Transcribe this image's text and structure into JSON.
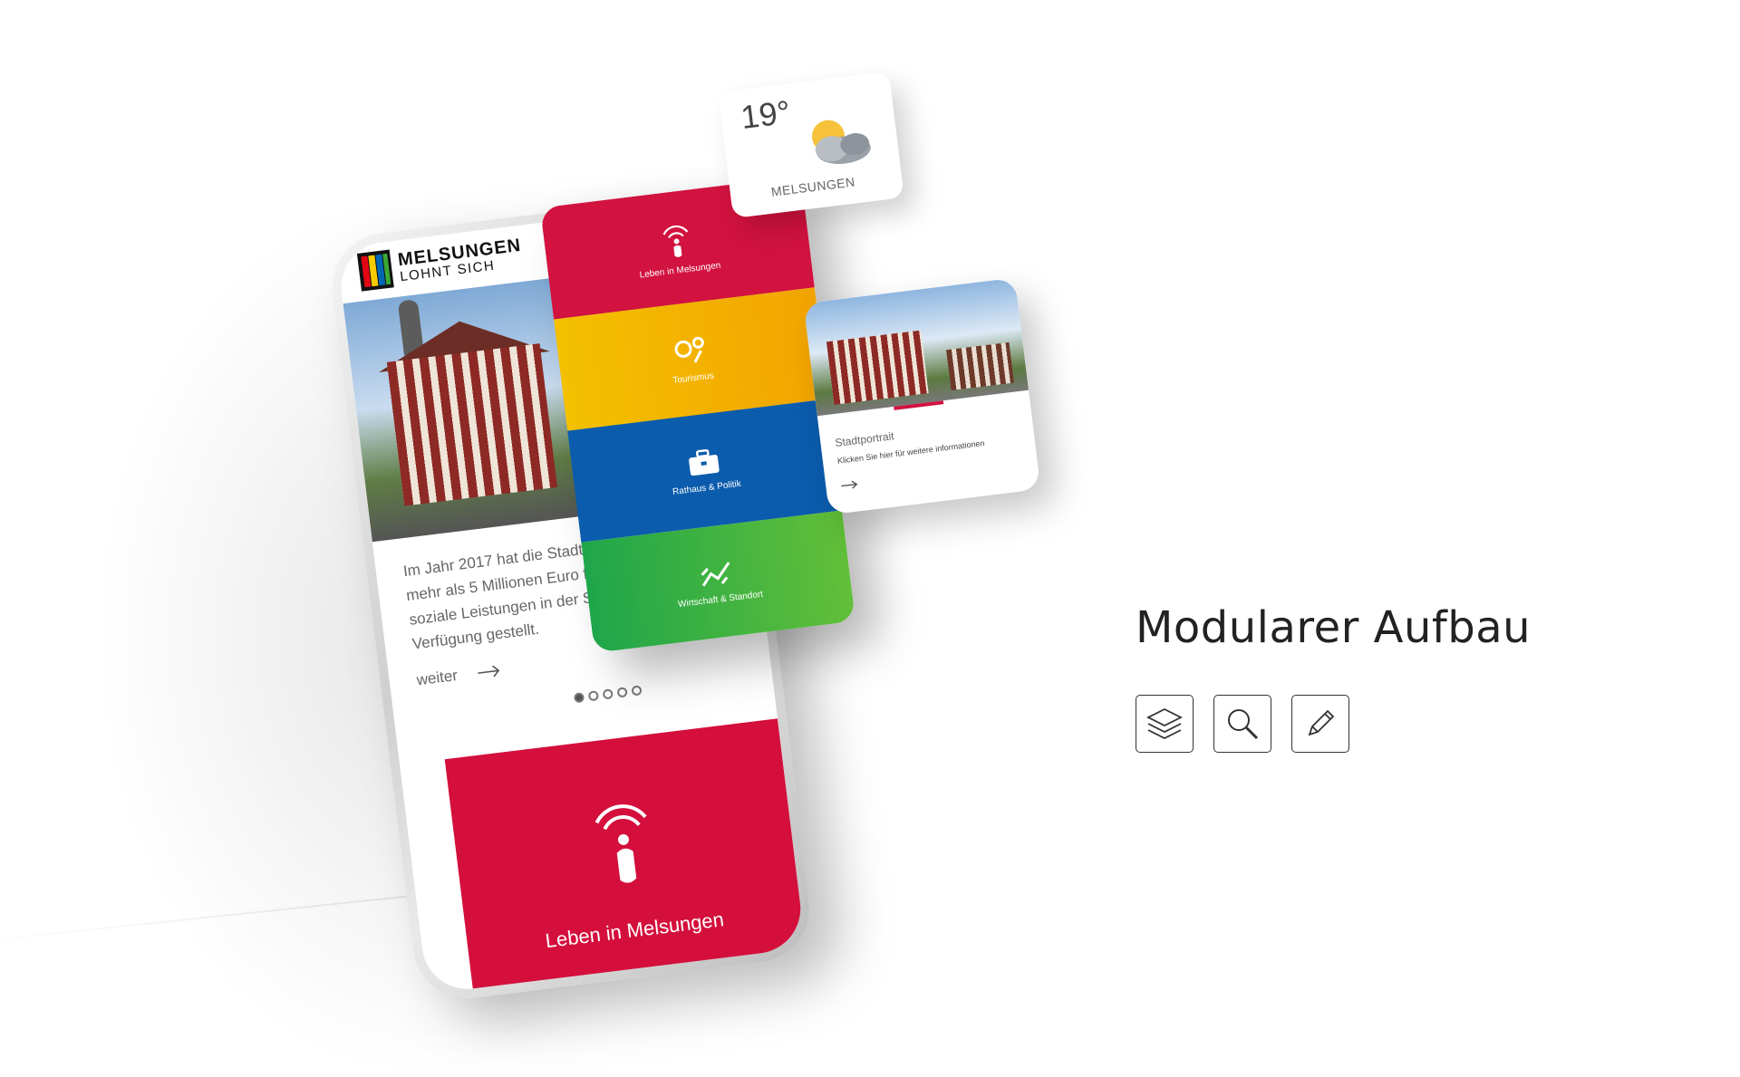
{
  "phone": {
    "logo": {
      "line1": "MELSUNGEN",
      "line2": "LOHNT SICH"
    },
    "teaser": {
      "text": "Im Jahr 2017 hat die Stadt Mel mehr als 5 Millionen Euro für fre soziale Leistungen in der Stadt Verfügung gestellt.",
      "link_label": "weiter"
    },
    "pager": {
      "total": 5,
      "active": 1
    },
    "feature_tile": {
      "label": "Leben in Melsungen",
      "color": "#d40f3c"
    }
  },
  "categories": [
    {
      "label": "Leben in Melsungen",
      "icon": "person-signal-icon",
      "color": "#d2123f"
    },
    {
      "label": "Tourismus",
      "icon": "map-pins-icon",
      "color": "#f4b400"
    },
    {
      "label": "Rathaus & Politik",
      "icon": "briefcase-icon",
      "color": "#0b5cad"
    },
    {
      "label": "Wirtschaft & Standort",
      "icon": "trend-line-icon",
      "color": "#3aaf45"
    }
  ],
  "weather": {
    "temperature": "19°",
    "city": "MELSUNGEN",
    "icon": "partly-cloudy-icon"
  },
  "portrait_card": {
    "title": "Stadtportrait",
    "subtitle": "Klicken Sie hier für weitere informationen",
    "accent": "#d2123f"
  },
  "headline": "Modularer Aufbau",
  "feature_icons": [
    "layers-icon",
    "search-icon",
    "pencil-icon"
  ]
}
